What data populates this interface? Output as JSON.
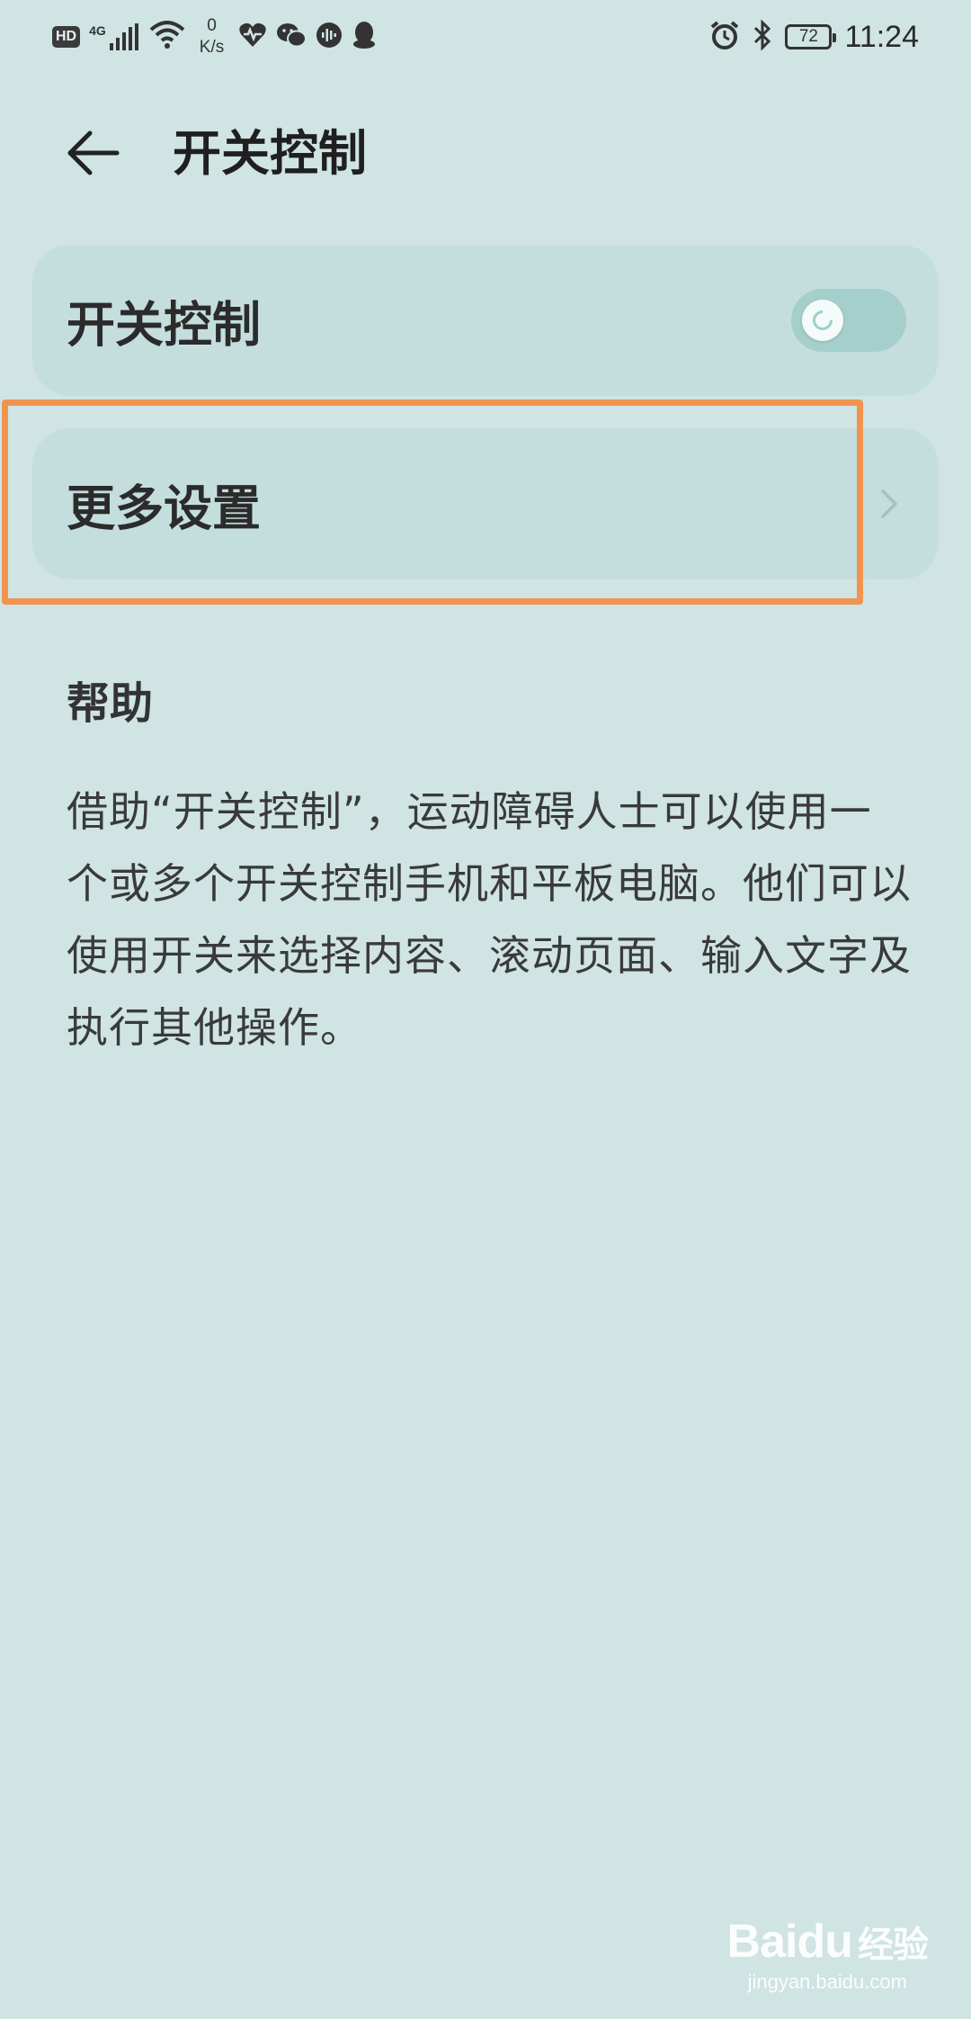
{
  "status_bar": {
    "hd": "HD",
    "network": "4G",
    "speed_value": "0",
    "speed_unit": "K/s",
    "battery": "72",
    "time": "11:24",
    "icons": [
      "signal-icon",
      "wifi-icon",
      "health-icon",
      "wechat-icon",
      "voice-icon",
      "qq-icon",
      "alarm-icon",
      "bluetooth-icon",
      "battery-icon"
    ]
  },
  "header": {
    "title": "开关控制",
    "back_icon": "back-arrow-icon"
  },
  "switch_card": {
    "label": "开关控制",
    "toggle_on": false
  },
  "more_card": {
    "label": "更多设置",
    "icon": "chevron-right-icon"
  },
  "help": {
    "title": "帮助",
    "body": "借助“开关控制”，运动障碍人士可以使用一个或多个开关控制手机和平板电脑。他们可以使用开关来选择内容、滚动页面、输入文字及执行其他操作。"
  },
  "watermark": {
    "brand": "Baidu",
    "brand_suffix": "经验",
    "site": "jingyan.baidu.com"
  },
  "colors": {
    "background": "#cfe4e3",
    "card": "#c4dedd",
    "toggle_track": "#a4cfcb",
    "highlight": "#f1944f"
  }
}
